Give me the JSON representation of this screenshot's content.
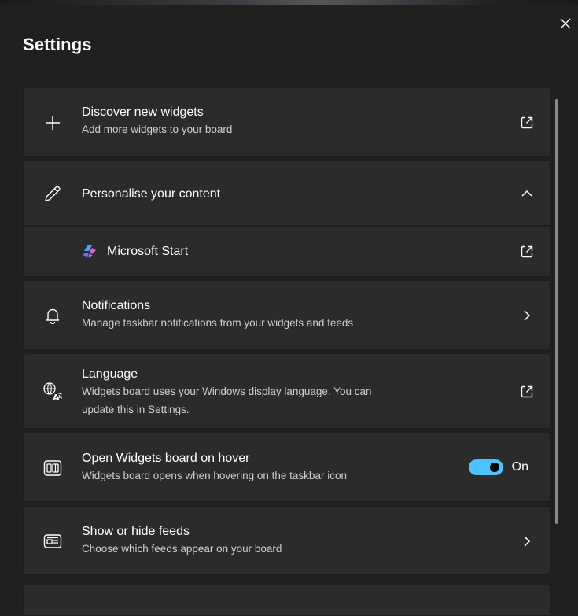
{
  "window": {
    "title": "Settings"
  },
  "items": {
    "discover": {
      "title": "Discover new widgets",
      "subtitle": "Add more widgets to your board",
      "icon": "plus-icon",
      "trailing_icon": "open-external-icon"
    },
    "personalise": {
      "title": "Personalise your content",
      "icon": "pencil-icon",
      "trailing_icon": "chevron-up-icon",
      "expanded": true
    },
    "microsoft_start": {
      "title": "Microsoft Start",
      "icon": "microsoft-start-logo",
      "trailing_icon": "open-external-icon"
    },
    "notifications": {
      "title": "Notifications",
      "subtitle": "Manage taskbar notifications from your widgets and feeds",
      "icon": "bell-icon",
      "trailing_icon": "chevron-right-icon"
    },
    "language": {
      "title": "Language",
      "subtitle": "Widgets board uses your Windows display language. You can update this in Settings.",
      "icon": "language-icon",
      "trailing_icon": "open-external-icon"
    },
    "hover": {
      "title": "Open Widgets board on hover",
      "subtitle": "Widgets board opens when hovering on the taskbar icon",
      "icon": "widgets-board-icon",
      "toggle_state": "On",
      "toggle_on": true
    },
    "feeds": {
      "title": "Show or hide feeds",
      "subtitle": "Choose which feeds appear on your board",
      "icon": "news-feed-icon",
      "trailing_icon": "chevron-right-icon"
    }
  },
  "colors": {
    "background": "#202020",
    "card": "#2b2b2b",
    "accent": "#4cc2ff"
  }
}
